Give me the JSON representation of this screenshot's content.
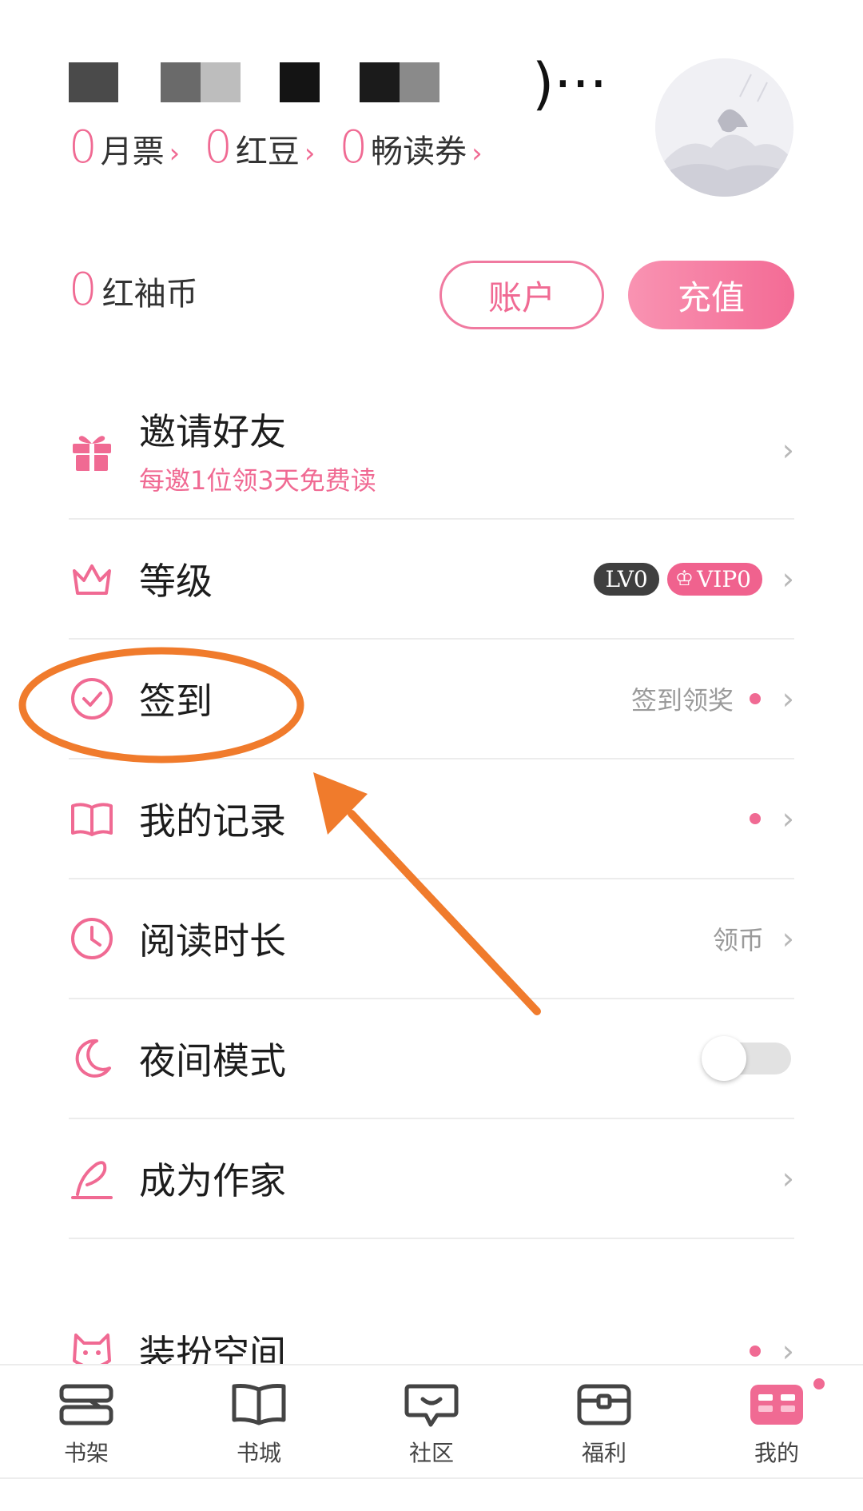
{
  "header": {
    "username_partial": ")···",
    "stats": [
      {
        "value": "0",
        "label": "月票",
        "chevron": "›"
      },
      {
        "value": "0",
        "label": "红豆",
        "chevron": "›"
      },
      {
        "value": "0",
        "label": "畅读券",
        "chevron": "›"
      }
    ],
    "coins": {
      "value": "0",
      "label": "红袖币"
    },
    "account_button": "账户",
    "recharge_button": "充值"
  },
  "menu": {
    "invite": {
      "title": "邀请好友",
      "subtitle": "每邀1位领3天免费读",
      "icon": "gift-icon"
    },
    "level": {
      "title": "等级",
      "lv_badge": "LV0",
      "vip_badge": "VIP0",
      "icon": "crown-icon"
    },
    "checkin": {
      "title": "签到",
      "hint": "签到领奖",
      "icon": "check-circle-icon"
    },
    "records": {
      "title": "我的记录",
      "icon": "book-open-icon"
    },
    "reading_time": {
      "title": "阅读时长",
      "hint": "领币",
      "icon": "clock-icon"
    },
    "night_mode": {
      "title": "夜间模式",
      "toggle_on": false,
      "icon": "moon-icon"
    },
    "writer": {
      "title": "成为作家",
      "icon": "quill-icon"
    },
    "dress_up": {
      "title": "装扮空间",
      "icon": "cat-icon"
    }
  },
  "tabs": [
    {
      "label": "书架",
      "icon": "bookshelf-icon",
      "active": false
    },
    {
      "label": "书城",
      "icon": "book-store-icon",
      "active": false
    },
    {
      "label": "社区",
      "icon": "chat-bubble-icon",
      "active": false
    },
    {
      "label": "福利",
      "icon": "treasure-chest-icon",
      "active": false
    },
    {
      "label": "我的",
      "icon": "profile-card-icon",
      "active": true
    }
  ],
  "colors": {
    "accent": "#f06a93",
    "annotation": "#f07b2c"
  }
}
